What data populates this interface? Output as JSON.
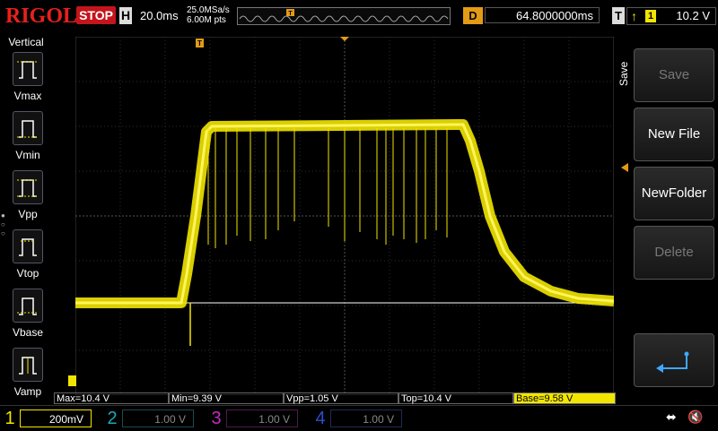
{
  "brand": "RIGOL",
  "run_state": "STOP",
  "horizontal": {
    "badge": "H",
    "timebase": "20.0ms",
    "sample_rate": "25.0MSa/s",
    "memory_depth": "6.00M pts"
  },
  "delay": {
    "badge": "D",
    "value": "64.8000000ms"
  },
  "trigger": {
    "badge": "T",
    "edge_icon": "rising-edge-icon",
    "source_channel": "1",
    "level": "10.2 V"
  },
  "vertical_menu": {
    "title": "Vertical",
    "items": [
      {
        "label": "Vmax",
        "icon": "vmax-measure-icon"
      },
      {
        "label": "Vmin",
        "icon": "vmin-measure-icon"
      },
      {
        "label": "Vpp",
        "icon": "vpp-measure-icon"
      },
      {
        "label": "Vtop",
        "icon": "vtop-measure-icon"
      },
      {
        "label": "Vbase",
        "icon": "vbase-measure-icon"
      },
      {
        "label": "Vamp",
        "icon": "vamp-measure-icon"
      }
    ]
  },
  "softkeys": {
    "title": "Save",
    "items": [
      {
        "label": "Save",
        "enabled": false
      },
      {
        "label": "New File",
        "enabled": true
      },
      {
        "label": "NewFolder",
        "enabled": true
      },
      {
        "label": "Delete",
        "enabled": false
      },
      {
        "label": "",
        "icon": "return-arrow-icon",
        "enabled": true
      }
    ]
  },
  "measurements": [
    {
      "text": "Max=10.4 V"
    },
    {
      "text": "Min=9.39 V"
    },
    {
      "text": "Vpp=1.05 V"
    },
    {
      "text": "Top=10.4 V"
    },
    {
      "text": "Base=9.58 V"
    }
  ],
  "channels": [
    {
      "number": "1",
      "scale": "200mV",
      "active": true,
      "color": "#f2e500"
    },
    {
      "number": "2",
      "scale": "1.00 V",
      "active": false,
      "color": "#1aa9b6"
    },
    {
      "number": "3",
      "scale": "1.00 V",
      "active": false,
      "color": "#c22cc2"
    },
    {
      "number": "4",
      "scale": "1.00 V",
      "active": false,
      "color": "#2c4fd0"
    }
  ],
  "status_icons": [
    "usb-icon",
    "speaker-mute-icon"
  ],
  "colors": {
    "ch1_trace": "#f2e500",
    "stop_badge": "#c4151c",
    "delay_badge": "#e39a16",
    "grid": "#3a3a3a"
  }
}
